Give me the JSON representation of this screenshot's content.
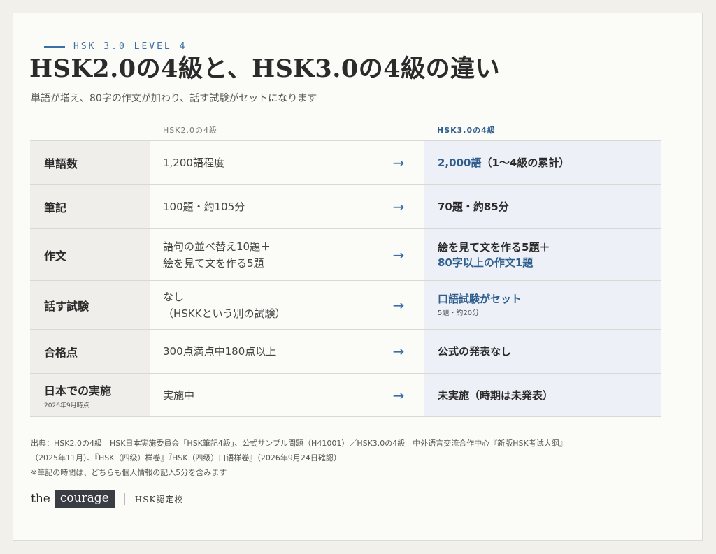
{
  "header": {
    "eyebrow": "HSK 3.0 LEVEL 4",
    "title": "HSK2.0の4級と、HSK3.0の4級の違い",
    "subtitle": "単語が増え、80字の作文が加わり、話す試験がセットになります"
  },
  "columns": {
    "old": "HSK2.0の4級",
    "new": "HSK3.0の4級"
  },
  "arrow": "→",
  "rows": [
    {
      "label": "単語数",
      "note": "",
      "old": [
        "1,200語程度"
      ],
      "new_blue": "2,000語",
      "new_dark": "（1〜4級の累計）",
      "new_note": ""
    },
    {
      "label": "筆記",
      "note": "",
      "old": [
        "100題・約105分"
      ],
      "new_dark1": "70題・約85分"
    },
    {
      "label": "作文",
      "note": "",
      "old": [
        "語句の並べ替え10題＋",
        "絵を見て文を作る5題"
      ],
      "new_dark1": "絵を見て文を作る5題＋",
      "new_blue2": "80字以上の作文1題"
    },
    {
      "label": "話す試験",
      "note": "",
      "old": [
        "なし",
        "（HSKKという別の試験）"
      ],
      "new_blue1": "口語試験がセット",
      "new_note": "5題・約20分"
    },
    {
      "label": "合格点",
      "note": "",
      "old": [
        "300点満点中180点以上"
      ],
      "new_dark1": "公式の発表なし"
    },
    {
      "label": "日本での実施",
      "note": "2026年9月時点",
      "old": [
        "実施中"
      ],
      "new_dark1": "未実施（時期は未発表）"
    }
  ],
  "source": {
    "line1": "出典：HSK2.0の4級＝HSK日本実施委員会「HSK筆記4級」、公式サンプル問題（H41001）／HSK3.0の4級＝中外语言交流合作中心『新版HSK考试大纲』",
    "line2": "（2025年11月）、『HSK（四级）样卷』『HSK（四级）口语样卷』（2026年9月24日確認）",
    "line3": "※筆記の時間は、どちらも個人情報の記入5分を含みます"
  },
  "footer": {
    "logo_the": "the",
    "logo_courage": "courage",
    "tag": "HSK認定校"
  },
  "colors": {
    "accent": "#3b6ea5",
    "accent_dark": "#2f5e8f",
    "label_bg": "#efeeea",
    "new_bg": "#edf0f6"
  }
}
